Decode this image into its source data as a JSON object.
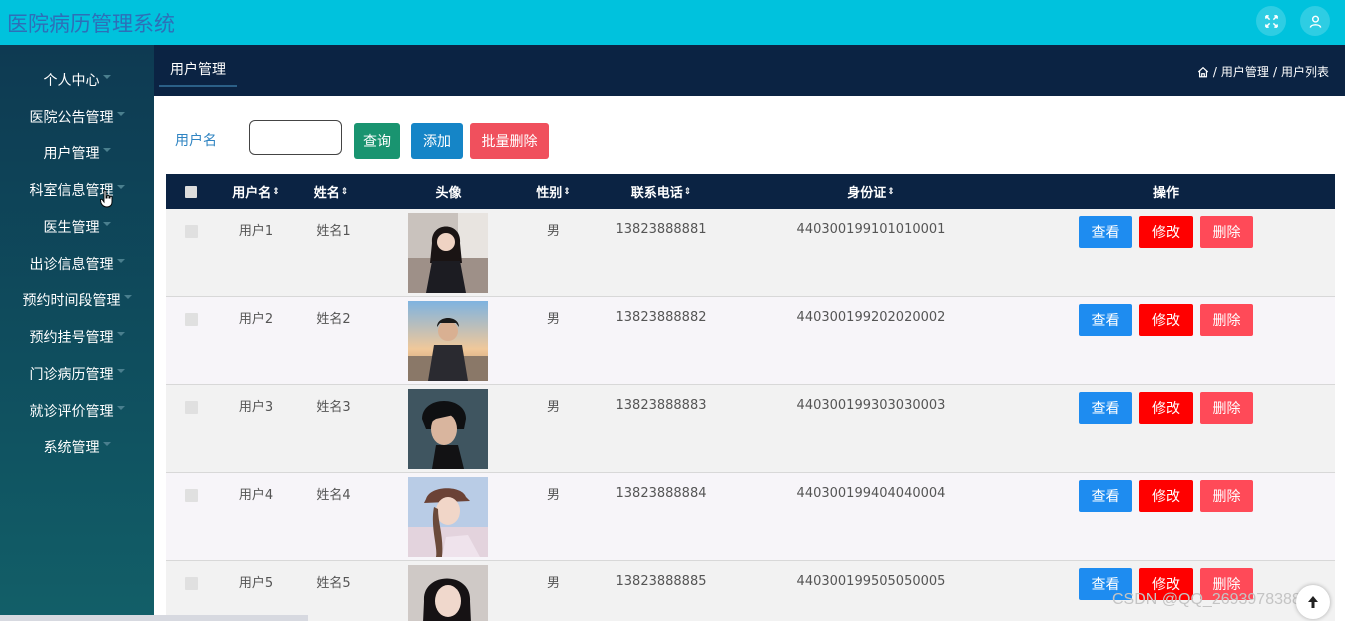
{
  "app": {
    "title": "医院病历管理系统"
  },
  "topbar": {
    "fullscreen_icon": "fullscreen-icon",
    "user_icon": "user-icon"
  },
  "sidebar": {
    "items": [
      {
        "label": "个人中心"
      },
      {
        "label": "医院公告管理"
      },
      {
        "label": "用户管理"
      },
      {
        "label": "科室信息管理"
      },
      {
        "label": "医生管理"
      },
      {
        "label": "出诊信息管理"
      },
      {
        "label": "预约时间段管理"
      },
      {
        "label": "预约挂号管理"
      },
      {
        "label": "门诊病历管理"
      },
      {
        "label": "就诊评价管理"
      },
      {
        "label": "系统管理"
      }
    ]
  },
  "subheader": {
    "tab_label": "用户管理",
    "breadcrumb": {
      "home_icon": "home-icon",
      "level1": "用户管理",
      "level2": "用户列表",
      "separator": "/"
    }
  },
  "search": {
    "label": "用户名",
    "value": "",
    "query_label": "查询",
    "add_label": "添加",
    "bulk_delete_label": "批量删除"
  },
  "table": {
    "columns": {
      "username": "用户名",
      "name": "姓名",
      "avatar": "头像",
      "gender": "性别",
      "phone": "联系电话",
      "idcard": "身份证",
      "actions": "操作",
      "sort_glyph": "⇕"
    },
    "actions": {
      "view": "查看",
      "edit": "修改",
      "delete": "删除"
    },
    "rows": [
      {
        "username": "用户1",
        "name": "姓名1",
        "gender": "男",
        "phone": "13823888881",
        "idcard": "440300199101010001"
      },
      {
        "username": "用户2",
        "name": "姓名2",
        "gender": "男",
        "phone": "13823888882",
        "idcard": "440300199202020002"
      },
      {
        "username": "用户3",
        "name": "姓名3",
        "gender": "男",
        "phone": "13823888883",
        "idcard": "440300199303030003"
      },
      {
        "username": "用户4",
        "name": "姓名4",
        "gender": "男",
        "phone": "13823888884",
        "idcard": "440300199404040004"
      },
      {
        "username": "用户5",
        "name": "姓名5",
        "gender": "男",
        "phone": "13823888885",
        "idcard": "440300199505050005"
      }
    ]
  },
  "watermark": "CSDN @QQ_2693978388",
  "colors": {
    "topbar": "#00c2dd",
    "sidebar": "#0f4a5c",
    "header": "#0b2343",
    "view": "#1e8cf0",
    "edit": "#ff0000",
    "delete": "#ff4a58"
  }
}
